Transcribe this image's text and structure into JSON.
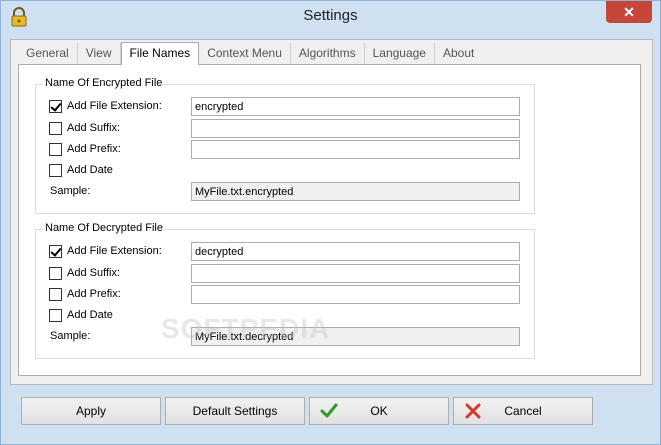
{
  "window": {
    "title": "Settings",
    "close_icon": "close-icon",
    "app_icon": "lock-icon"
  },
  "tabs": [
    {
      "label": "General"
    },
    {
      "label": "View"
    },
    {
      "label": "File Names"
    },
    {
      "label": "Context Menu"
    },
    {
      "label": "Algorithms"
    },
    {
      "label": "Language"
    },
    {
      "label": "About"
    }
  ],
  "encrypted": {
    "title": "Name Of Encrypted File",
    "ext_label": "Add File Extension:",
    "ext_checked": true,
    "ext_value": "encrypted",
    "suffix_label": "Add Suffix:",
    "suffix_checked": false,
    "suffix_value": "",
    "prefix_label": "Add Prefix:",
    "prefix_checked": false,
    "prefix_value": "",
    "date_label": "Add Date",
    "date_checked": false,
    "sample_label": "Sample:",
    "sample_value": "MyFile.txt.encrypted"
  },
  "decrypted": {
    "title": "Name Of Decrypted File",
    "ext_label": "Add File Extension:",
    "ext_checked": true,
    "ext_value": "decrypted",
    "suffix_label": "Add Suffix:",
    "suffix_checked": false,
    "suffix_value": "",
    "prefix_label": "Add Prefix:",
    "prefix_checked": false,
    "prefix_value": "",
    "date_label": "Add Date",
    "date_checked": false,
    "sample_label": "Sample:",
    "sample_value": "MyFile.txt.decrypted"
  },
  "buttons": {
    "apply": "Apply",
    "default": "Default Settings",
    "ok": "OK",
    "cancel": "Cancel"
  },
  "colors": {
    "ok_check": "#2e9a2e",
    "cancel_x": "#d23a2a",
    "close_bg": "#c7463a"
  },
  "watermark": "SOFTPEDIA"
}
